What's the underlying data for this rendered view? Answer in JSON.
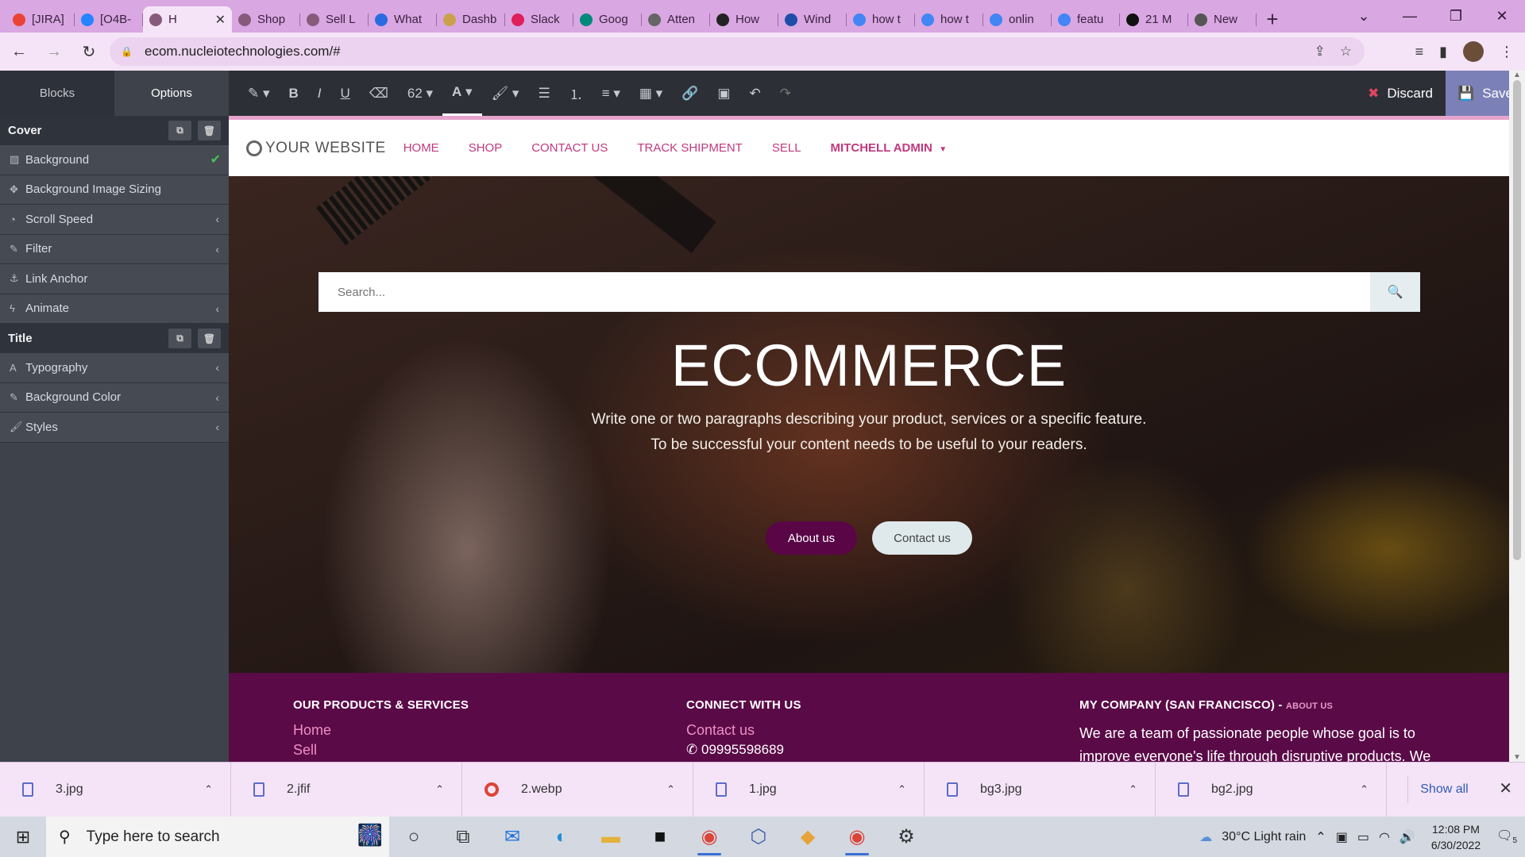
{
  "browser": {
    "tabs": [
      {
        "label": "[JIRA]",
        "icon": "gmail-icon",
        "color": "#ea4335"
      },
      {
        "label": "[O4B-",
        "icon": "jira-icon",
        "color": "#2684ff"
      },
      {
        "label": "H",
        "icon": "odoo-icon",
        "color": "#875a7b",
        "active": true
      },
      {
        "label": "Shop",
        "icon": "odoo-icon",
        "color": "#875a7b"
      },
      {
        "label": "Sell L",
        "icon": "odoo-icon",
        "color": "#875a7b"
      },
      {
        "label": "What",
        "icon": "arrow-icon",
        "color": "#2a6be0"
      },
      {
        "label": "Dashb",
        "icon": "dashboard-icon",
        "color": "#c9a14a"
      },
      {
        "label": "Slack",
        "icon": "slack-icon",
        "color": "#e01e5a"
      },
      {
        "label": "Goog",
        "icon": "google-meet-icon",
        "color": "#00897b"
      },
      {
        "label": "Atten",
        "icon": "globe-icon",
        "color": "#666666"
      },
      {
        "label": "How",
        "icon": "b-icon",
        "color": "#222222"
      },
      {
        "label": "Wind",
        "icon": "vmware-icon",
        "color": "#1d4ea7"
      },
      {
        "label": "how t",
        "icon": "google-icon",
        "color": "#4285f4"
      },
      {
        "label": "how t",
        "icon": "google-icon",
        "color": "#4285f4"
      },
      {
        "label": "onlin",
        "icon": "google-icon",
        "color": "#4285f4"
      },
      {
        "label": "featu",
        "icon": "google-icon",
        "color": "#4285f4"
      },
      {
        "label": "21 M",
        "icon": "sej-icon",
        "color": "#111111"
      },
      {
        "label": "New",
        "icon": "chrome-icon",
        "color": "#555555"
      }
    ],
    "url": "ecom.nucleiotechnologies.com/#"
  },
  "editor": {
    "sidebar_tabs": [
      "Blocks",
      "Options"
    ],
    "sections": [
      {
        "title": "Cover",
        "items": [
          {
            "label": "Background",
            "icon": "image-icon",
            "checked": true
          },
          {
            "label": "Background Image Sizing",
            "icon": "move-icon"
          },
          {
            "label": "Scroll Speed",
            "icon": "gauge-icon",
            "expandable": true
          },
          {
            "label": "Filter",
            "icon": "eyedropper-icon",
            "expandable": true
          },
          {
            "label": "Link Anchor",
            "icon": "anchor-icon"
          },
          {
            "label": "Animate",
            "icon": "bolt-icon",
            "expandable": true
          }
        ]
      },
      {
        "title": "Title",
        "items": [
          {
            "label": "Typography",
            "icon": "font-icon",
            "expandable": true
          },
          {
            "label": "Background Color",
            "icon": "eyedropper-icon",
            "expandable": true
          },
          {
            "label": "Styles",
            "icon": "brush-icon",
            "expandable": true
          }
        ]
      }
    ],
    "toolbar": {
      "font_size": "62",
      "discard_label": "Discard",
      "save_label": "Save"
    }
  },
  "site": {
    "logo": "YOUR WEBSITE",
    "nav": [
      "HOME",
      "SHOP",
      "CONTACT US",
      "TRACK SHIPMENT",
      "SELL"
    ],
    "user": "MITCHELL ADMIN",
    "search_placeholder": "Search...",
    "hero_title": "ECOMMERCE",
    "hero_text_1": "Write one or two paragraphs describing your product, services or a specific feature.",
    "hero_text_2": "To be successful your content needs to be useful to your readers.",
    "btn_about": "About us",
    "btn_contact": "Contact us",
    "footer": {
      "col1_title": "OUR PRODUCTS & SERVICES",
      "col1_links": [
        "Home",
        "Sell"
      ],
      "col2_title": "CONNECT WITH US",
      "col2_link": "Contact us",
      "col2_phone": "09995598689",
      "col3_title": "MY COMPANY (SAN FRANCISCO) -",
      "col3_small": "ABOUT US",
      "col3_text": "We are a team of passionate people whose goal is to improve everyone's life through disruptive products. We"
    }
  },
  "downloads": {
    "files": [
      {
        "name": "3.jpg",
        "icon": "file-icon"
      },
      {
        "name": "2.jfif",
        "icon": "file-icon"
      },
      {
        "name": "2.webp",
        "icon": "chrome-icon"
      },
      {
        "name": "1.jpg",
        "icon": "file-icon"
      },
      {
        "name": "bg3.jpg",
        "icon": "file-icon"
      },
      {
        "name": "bg2.jpg",
        "icon": "file-icon"
      }
    ],
    "show_all": "Show all"
  },
  "taskbar": {
    "search_placeholder": "Type here to search",
    "weather": "30°C  Light rain",
    "time": "12:08 PM",
    "date": "6/30/2022",
    "notifications": "5"
  },
  "colors": {
    "accent": "#5a0546",
    "nav_pink": "#c0397f",
    "footer_bg": "#5a0a47",
    "save_bg": "#7b81b7",
    "discard_x": "#e0455f"
  }
}
